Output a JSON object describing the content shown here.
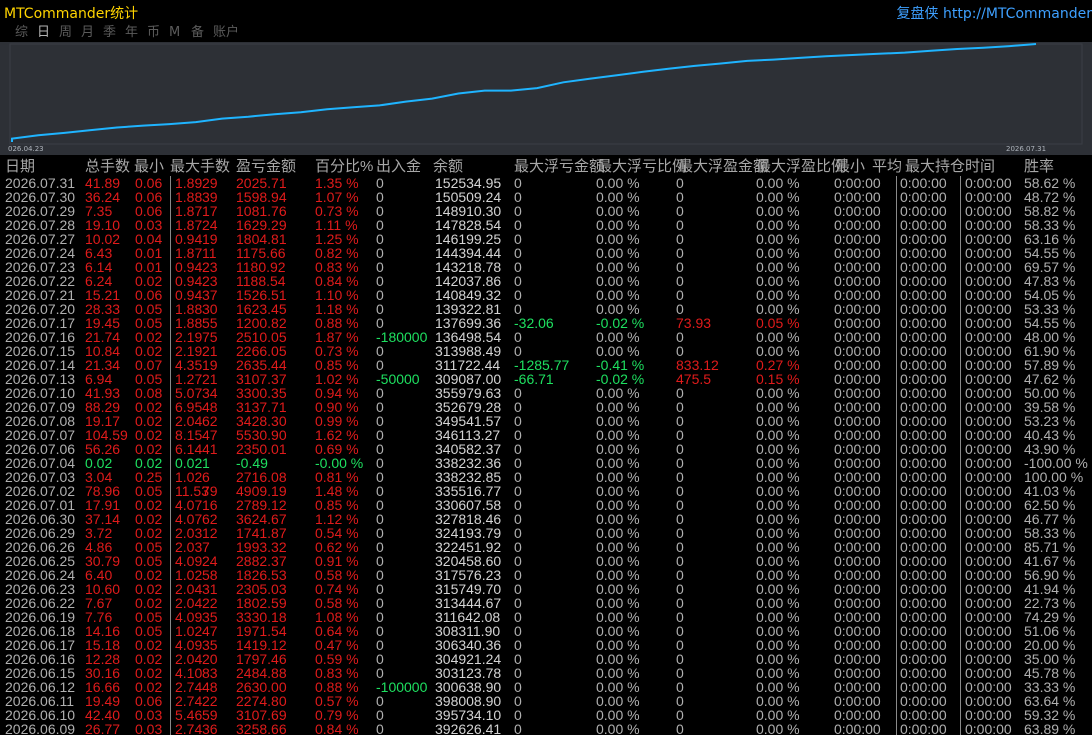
{
  "window": {
    "title": "MTCommander统计",
    "right_label": "复盘侠 http://MTCommander"
  },
  "tabs": [
    {
      "label": "综",
      "active": false
    },
    {
      "label": "日",
      "active": true
    },
    {
      "label": "周",
      "active": false
    },
    {
      "label": "月",
      "active": false
    },
    {
      "label": "季",
      "active": false
    },
    {
      "label": "年",
      "active": false
    },
    {
      "label": "币",
      "active": false
    },
    {
      "label": "M",
      "active": false
    },
    {
      "label": "备",
      "active": false
    },
    {
      "label": "账户",
      "active": false
    }
  ],
  "chart": {
    "start_label": "026.04.23",
    "end_label": "2026.07.31",
    "line_color": "#1fb4ff"
  },
  "table": {
    "headers": [
      "日期",
      "总手数",
      "最小",
      "最大手数",
      "盈亏金额",
      "百分比%",
      "出入金",
      "余额",
      "最大浮亏金额",
      "最大浮亏比例",
      "最大浮盈金额",
      "最大浮盈比例",
      "最小",
      "平均",
      "最大持仓时间",
      "胜率"
    ],
    "rows": [
      [
        "2026.07.31",
        "41.89",
        "0.06",
        "1.89",
        "29",
        "2025.71",
        "1.35 %",
        "0",
        "152534.95",
        "0",
        "0.00 %",
        "0",
        "0.00 %",
        "0:00:00",
        "0:00:00",
        "0:00:00",
        "58.62 %"
      ],
      [
        "2026.07.30",
        "36.24",
        "0.06",
        "1.88",
        "39",
        "1598.94",
        "1.07 %",
        "0",
        "150509.24",
        "0",
        "0.00 %",
        "0",
        "0.00 %",
        "0:00:00",
        "0:00:00",
        "0:00:00",
        "48.72 %"
      ],
      [
        "2026.07.29",
        "7.35",
        "0.06",
        "1.87",
        "17",
        "1081.76",
        "0.73 %",
        "0",
        "148910.30",
        "0",
        "0.00 %",
        "0",
        "0.00 %",
        "0:00:00",
        "0:00:00",
        "0:00:00",
        "58.82 %"
      ],
      [
        "2026.07.28",
        "19.10",
        "0.03",
        "1.87",
        "24",
        "1629.29",
        "1.11 %",
        "0",
        "147828.54",
        "0",
        "0.00 %",
        "0",
        "0.00 %",
        "0:00:00",
        "0:00:00",
        "0:00:00",
        "58.33 %"
      ],
      [
        "2026.07.27",
        "10.02",
        "0.04",
        "0.94",
        "19",
        "1804.81",
        "1.25 %",
        "0",
        "146199.25",
        "0",
        "0.00 %",
        "0",
        "0.00 %",
        "0:00:00",
        "0:00:00",
        "0:00:00",
        "63.16 %"
      ],
      [
        "2026.07.24",
        "6.43",
        "0.01",
        "1.87",
        "11",
        "1175.66",
        "0.82 %",
        "0",
        "144394.44",
        "0",
        "0.00 %",
        "0",
        "0.00 %",
        "0:00:00",
        "0:00:00",
        "0:00:00",
        "54.55 %"
      ],
      [
        "2026.07.23",
        "6.14",
        "0.01",
        "0.94",
        "23",
        "1180.92",
        "0.83 %",
        "0",
        "143218.78",
        "0",
        "0.00 %",
        "0",
        "0.00 %",
        "0:00:00",
        "0:00:00",
        "0:00:00",
        "69.57 %"
      ],
      [
        "2026.07.22",
        "6.24",
        "0.02",
        "0.94",
        "23",
        "1188.54",
        "0.84 %",
        "0",
        "142037.86",
        "0",
        "0.00 %",
        "0",
        "0.00 %",
        "0:00:00",
        "0:00:00",
        "0:00:00",
        "47.83 %"
      ],
      [
        "2026.07.21",
        "15.21",
        "0.06",
        "0.94",
        "37",
        "1526.51",
        "1.10 %",
        "0",
        "140849.32",
        "0",
        "0.00 %",
        "0",
        "0.00 %",
        "0:00:00",
        "0:00:00",
        "0:00:00",
        "54.05 %"
      ],
      [
        "2026.07.20",
        "28.33",
        "0.05",
        "1.88",
        "30",
        "1623.45",
        "1.18 %",
        "0",
        "139322.81",
        "0",
        "0.00 %",
        "0",
        "0.00 %",
        "0:00:00",
        "0:00:00",
        "0:00:00",
        "53.33 %"
      ],
      [
        "2026.07.17",
        "19.45",
        "0.05",
        "1.88",
        "55",
        "1200.82",
        "0.88 %",
        "0",
        "137699.36",
        "-32.06",
        "-0.02 %",
        "73.93",
        "0.05 %",
        "0:00:00",
        "0:00:00",
        "0:00:00",
        "54.55 %"
      ],
      [
        "2026.07.16",
        "21.74",
        "0.02",
        "2.19",
        "75",
        "2510.05",
        "1.87 %",
        "-180000",
        "136498.54",
        "0",
        "0.00 %",
        "0",
        "0.00 %",
        "0:00:00",
        "0:00:00",
        "0:00:00",
        "48.00 %"
      ],
      [
        "2026.07.15",
        "10.84",
        "0.02",
        "2.19",
        "21",
        "2266.05",
        "0.73 %",
        "0",
        "313988.49",
        "0",
        "0.00 %",
        "0",
        "0.00 %",
        "0:00:00",
        "0:00:00",
        "0:00:00",
        "61.90 %"
      ],
      [
        "2026.07.14",
        "21.34",
        "0.07",
        "4.35",
        "19",
        "2635.44",
        "0.85 %",
        "0",
        "311722.44",
        "-1285.77",
        "-0.41 %",
        "833.12",
        "0.27 %",
        "0:00:00",
        "0:00:00",
        "0:00:00",
        "57.89 %"
      ],
      [
        "2026.07.13",
        "6.94",
        "0.05",
        "1.27",
        "21",
        "3107.37",
        "1.02 %",
        "-50000",
        "309087.00",
        "-66.71",
        "-0.02 %",
        "475.5",
        "0.15 %",
        "0:00:00",
        "0:00:00",
        "0:00:00",
        "47.62 %"
      ],
      [
        "2026.07.10",
        "41.93",
        "0.08",
        "5.07",
        "34",
        "3300.35",
        "0.94 %",
        "0",
        "355979.63",
        "0",
        "0.00 %",
        "0",
        "0.00 %",
        "0:00:00",
        "0:00:00",
        "0:00:00",
        "50.00 %"
      ],
      [
        "2026.07.09",
        "88.29",
        "0.02",
        "6.95",
        "48",
        "3137.71",
        "0.90 %",
        "0",
        "352679.28",
        "0",
        "0.00 %",
        "0",
        "0.00 %",
        "0:00:00",
        "0:00:00",
        "0:00:00",
        "39.58 %"
      ],
      [
        "2026.07.08",
        "19.17",
        "0.02",
        "2.04",
        "62",
        "3428.30",
        "0.99 %",
        "0",
        "349541.57",
        "0",
        "0.00 %",
        "0",
        "0.00 %",
        "0:00:00",
        "0:00:00",
        "0:00:00",
        "53.23 %"
      ],
      [
        "2026.07.07",
        "104.59",
        "0.02",
        "8.15",
        "47",
        "5530.90",
        "1.62 %",
        "0",
        "346113.27",
        "0",
        "0.00 %",
        "0",
        "0.00 %",
        "0:00:00",
        "0:00:00",
        "0:00:00",
        "40.43 %"
      ],
      [
        "2026.07.06",
        "56.26",
        "0.02",
        "6.14",
        "41",
        "2350.01",
        "0.69 %",
        "0",
        "340582.37",
        "0",
        "0.00 %",
        "0",
        "0.00 %",
        "0:00:00",
        "0:00:00",
        "0:00:00",
        "43.90 %"
      ],
      [
        "2026.07.04",
        "0.02",
        "0.02",
        "0.02",
        "1",
        "-0.49",
        "-0.00 %",
        "0",
        "338232.36",
        "0",
        "0.00 %",
        "0",
        "0.00 %",
        "0:00:00",
        "0:00:00",
        "0:00:00",
        "-100.00 %"
      ],
      [
        "2026.07.03",
        "3.04",
        "0.25",
        "1.02",
        "6",
        "2716.08",
        "0.81 %",
        "0",
        "338232.85",
        "0",
        "0.00 %",
        "0",
        "0.00 %",
        "0:00:00",
        "0:00:00",
        "0:00:00",
        "100.00 %"
      ],
      [
        "2026.07.02",
        "78.96",
        "0.05",
        "11.53",
        "79",
        "4909.19",
        "1.48 %",
        "0",
        "335516.77",
        "0",
        "0.00 %",
        "0",
        "0.00 %",
        "0:00:00",
        "0:00:00",
        "0:00:00",
        "41.03 %"
      ],
      [
        "2026.07.01",
        "17.91",
        "0.02",
        "4.07",
        "16",
        "2789.12",
        "0.85 %",
        "0",
        "330607.58",
        "0",
        "0.00 %",
        "0",
        "0.00 %",
        "0:00:00",
        "0:00:00",
        "0:00:00",
        "62.50 %"
      ],
      [
        "2026.06.30",
        "37.14",
        "0.02",
        "4.07",
        "62",
        "3624.67",
        "1.12 %",
        "0",
        "327818.46",
        "0",
        "0.00 %",
        "0",
        "0.00 %",
        "0:00:00",
        "0:00:00",
        "0:00:00",
        "46.77 %"
      ],
      [
        "2026.06.29",
        "3.72",
        "0.02",
        "2.03",
        "12",
        "1741.87",
        "0.54 %",
        "0",
        "324193.79",
        "0",
        "0.00 %",
        "0",
        "0.00 %",
        "0:00:00",
        "0:00:00",
        "0:00:00",
        "58.33 %"
      ],
      [
        "2026.06.26",
        "4.86",
        "0.05",
        "2.03",
        "7",
        "1993.32",
        "0.62 %",
        "0",
        "322451.92",
        "0",
        "0.00 %",
        "0",
        "0.00 %",
        "0:00:00",
        "0:00:00",
        "0:00:00",
        "85.71 %"
      ],
      [
        "2026.06.25",
        "30.79",
        "0.05",
        "4.09",
        "24",
        "2882.37",
        "0.91 %",
        "0",
        "320458.60",
        "0",
        "0.00 %",
        "0",
        "0.00 %",
        "0:00:00",
        "0:00:00",
        "0:00:00",
        "41.67 %"
      ],
      [
        "2026.06.24",
        "6.40",
        "0.02",
        "1.02",
        "58",
        "1826.53",
        "0.58 %",
        "0",
        "317576.23",
        "0",
        "0.00 %",
        "0",
        "0.00 %",
        "0:00:00",
        "0:00:00",
        "0:00:00",
        "56.90 %"
      ],
      [
        "2026.06.23",
        "10.60",
        "0.02",
        "2.04",
        "31",
        "2305.03",
        "0.74 %",
        "0",
        "315749.70",
        "0",
        "0.00 %",
        "0",
        "0.00 %",
        "0:00:00",
        "0:00:00",
        "0:00:00",
        "41.94 %"
      ],
      [
        "2026.06.22",
        "7.67",
        "0.02",
        "2.04",
        "22",
        "1802.59",
        "0.58 %",
        "0",
        "313444.67",
        "0",
        "0.00 %",
        "0",
        "0.00 %",
        "0:00:00",
        "0:00:00",
        "0:00:00",
        "22.73 %"
      ],
      [
        "2026.06.19",
        "7.76",
        "0.05",
        "4.09",
        "35",
        "3330.18",
        "1.08 %",
        "0",
        "311642.08",
        "0",
        "0.00 %",
        "0",
        "0.00 %",
        "0:00:00",
        "0:00:00",
        "0:00:00",
        "74.29 %"
      ],
      [
        "2026.06.18",
        "14.16",
        "0.05",
        "1.02",
        "47",
        "1971.54",
        "0.64 %",
        "0",
        "308311.90",
        "0",
        "0.00 %",
        "0",
        "0.00 %",
        "0:00:00",
        "0:00:00",
        "0:00:00",
        "51.06 %"
      ],
      [
        "2026.06.17",
        "15.18",
        "0.02",
        "4.09",
        "35",
        "1419.12",
        "0.47 %",
        "0",
        "306340.36",
        "0",
        "0.00 %",
        "0",
        "0.00 %",
        "0:00:00",
        "0:00:00",
        "0:00:00",
        "20.00 %"
      ],
      [
        "2026.06.16",
        "12.28",
        "0.02",
        "2.04",
        "20",
        "1797.46",
        "0.59 %",
        "0",
        "304921.24",
        "0",
        "0.00 %",
        "0",
        "0.00 %",
        "0:00:00",
        "0:00:00",
        "0:00:00",
        "35.00 %"
      ],
      [
        "2026.06.15",
        "30.16",
        "0.02",
        "4.10",
        "83",
        "2484.88",
        "0.83 %",
        "0",
        "303123.78",
        "0",
        "0.00 %",
        "0",
        "0.00 %",
        "0:00:00",
        "0:00:00",
        "0:00:00",
        "45.78 %"
      ],
      [
        "2026.06.12",
        "16.66",
        "0.02",
        "2.74",
        "48",
        "2630.00",
        "0.88 %",
        "-100000",
        "300638.90",
        "0",
        "0.00 %",
        "0",
        "0.00 %",
        "0:00:00",
        "0:00:00",
        "0:00:00",
        "33.33 %"
      ],
      [
        "2026.06.11",
        "19.49",
        "0.06",
        "2.74",
        "22",
        "2274.80",
        "0.57 %",
        "0",
        "398008.90",
        "0",
        "0.00 %",
        "0",
        "0.00 %",
        "0:00:00",
        "0:00:00",
        "0:00:00",
        "63.64 %"
      ],
      [
        "2026.06.10",
        "42.40",
        "0.03",
        "5.46",
        "59",
        "3107.69",
        "0.79 %",
        "0",
        "395734.10",
        "0",
        "0.00 %",
        "0",
        "0.00 %",
        "0:00:00",
        "0:00:00",
        "0:00:00",
        "59.32 %"
      ],
      [
        "2026.06.09",
        "26.77",
        "0.03",
        "2.74",
        "36",
        "3258.66",
        "0.84 %",
        "0",
        "392626.41",
        "0",
        "0.00 %",
        "0",
        "0.00 %",
        "0:00:00",
        "0:00:00",
        "0:00:00",
        "63.89 %"
      ]
    ]
  }
}
